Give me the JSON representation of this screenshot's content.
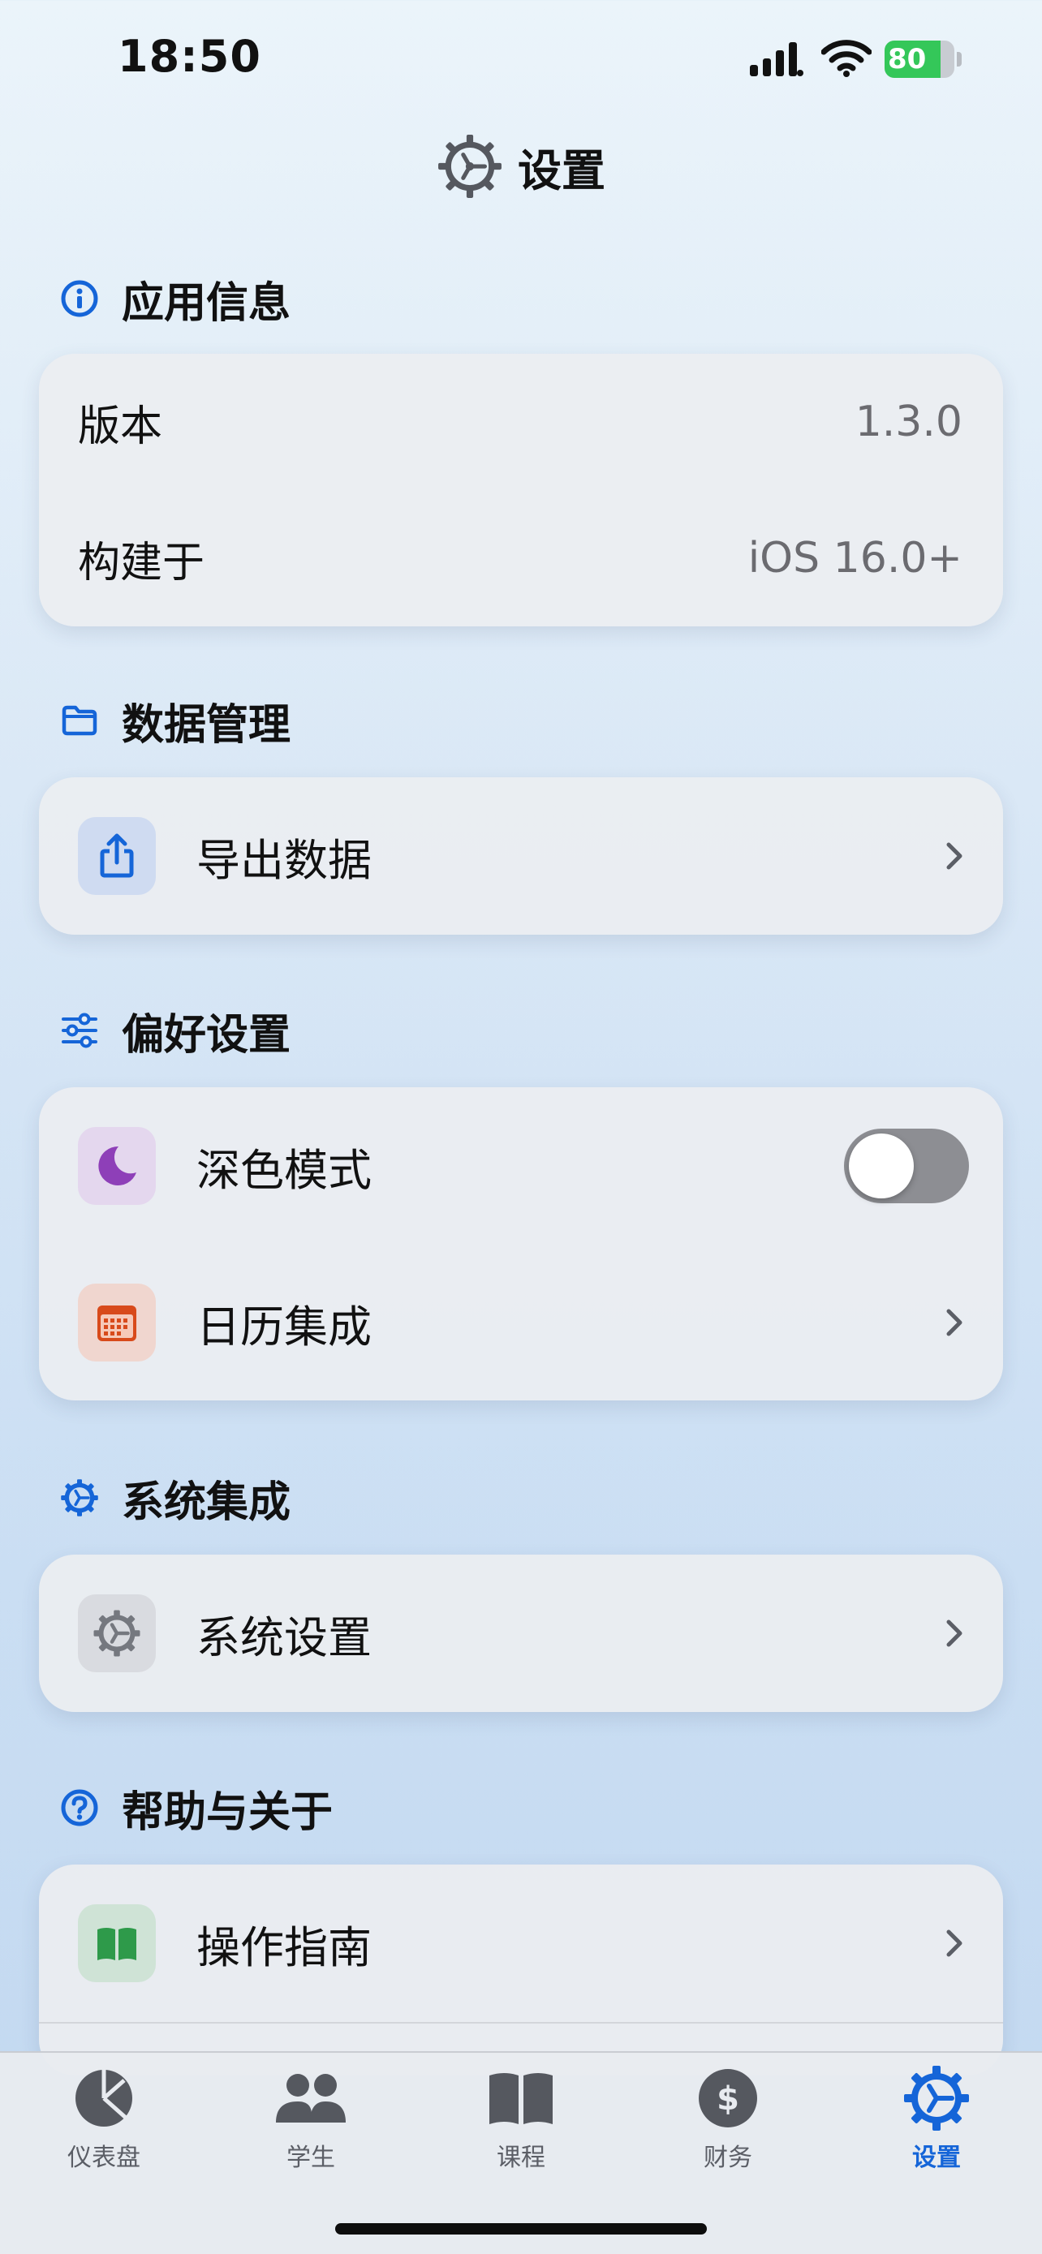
{
  "status_bar": {
    "time": "18:50",
    "battery": "80",
    "battery_level": 0.8
  },
  "nav": {
    "title": "设置"
  },
  "sections": {
    "app_info": {
      "title": "应用信息",
      "rows": [
        {
          "label": "版本",
          "value": "1.3.0"
        },
        {
          "label": "构建于",
          "value": "iOS 16.0+"
        }
      ]
    },
    "data_management": {
      "title": "数据管理",
      "rows": [
        {
          "label": "导出数据",
          "icon": "share-icon"
        }
      ]
    },
    "preferences": {
      "title": "偏好设置",
      "rows": [
        {
          "label": "深色模式",
          "icon": "moon-icon",
          "toggle_on": false
        },
        {
          "label": "日历集成",
          "icon": "calendar-icon"
        }
      ]
    },
    "system_integration": {
      "title": "系统集成",
      "rows": [
        {
          "label": "系统设置",
          "icon": "gear-icon"
        }
      ]
    },
    "help_about": {
      "title": "帮助与关于",
      "rows": [
        {
          "label": "操作指南",
          "icon": "book-icon"
        }
      ]
    }
  },
  "tab_bar": {
    "tabs": [
      {
        "label": "仪表盘",
        "icon": "pie-chart-icon"
      },
      {
        "label": "学生",
        "icon": "people-icon"
      },
      {
        "label": "课程",
        "icon": "book-icon"
      },
      {
        "label": "财务",
        "icon": "dollar-icon"
      },
      {
        "label": "设置",
        "icon": "gear-icon",
        "active": true
      }
    ]
  },
  "colors": {
    "accent": "#1565d8",
    "toggle_off": "#8d8e93",
    "battery_fill": "#34c759"
  }
}
